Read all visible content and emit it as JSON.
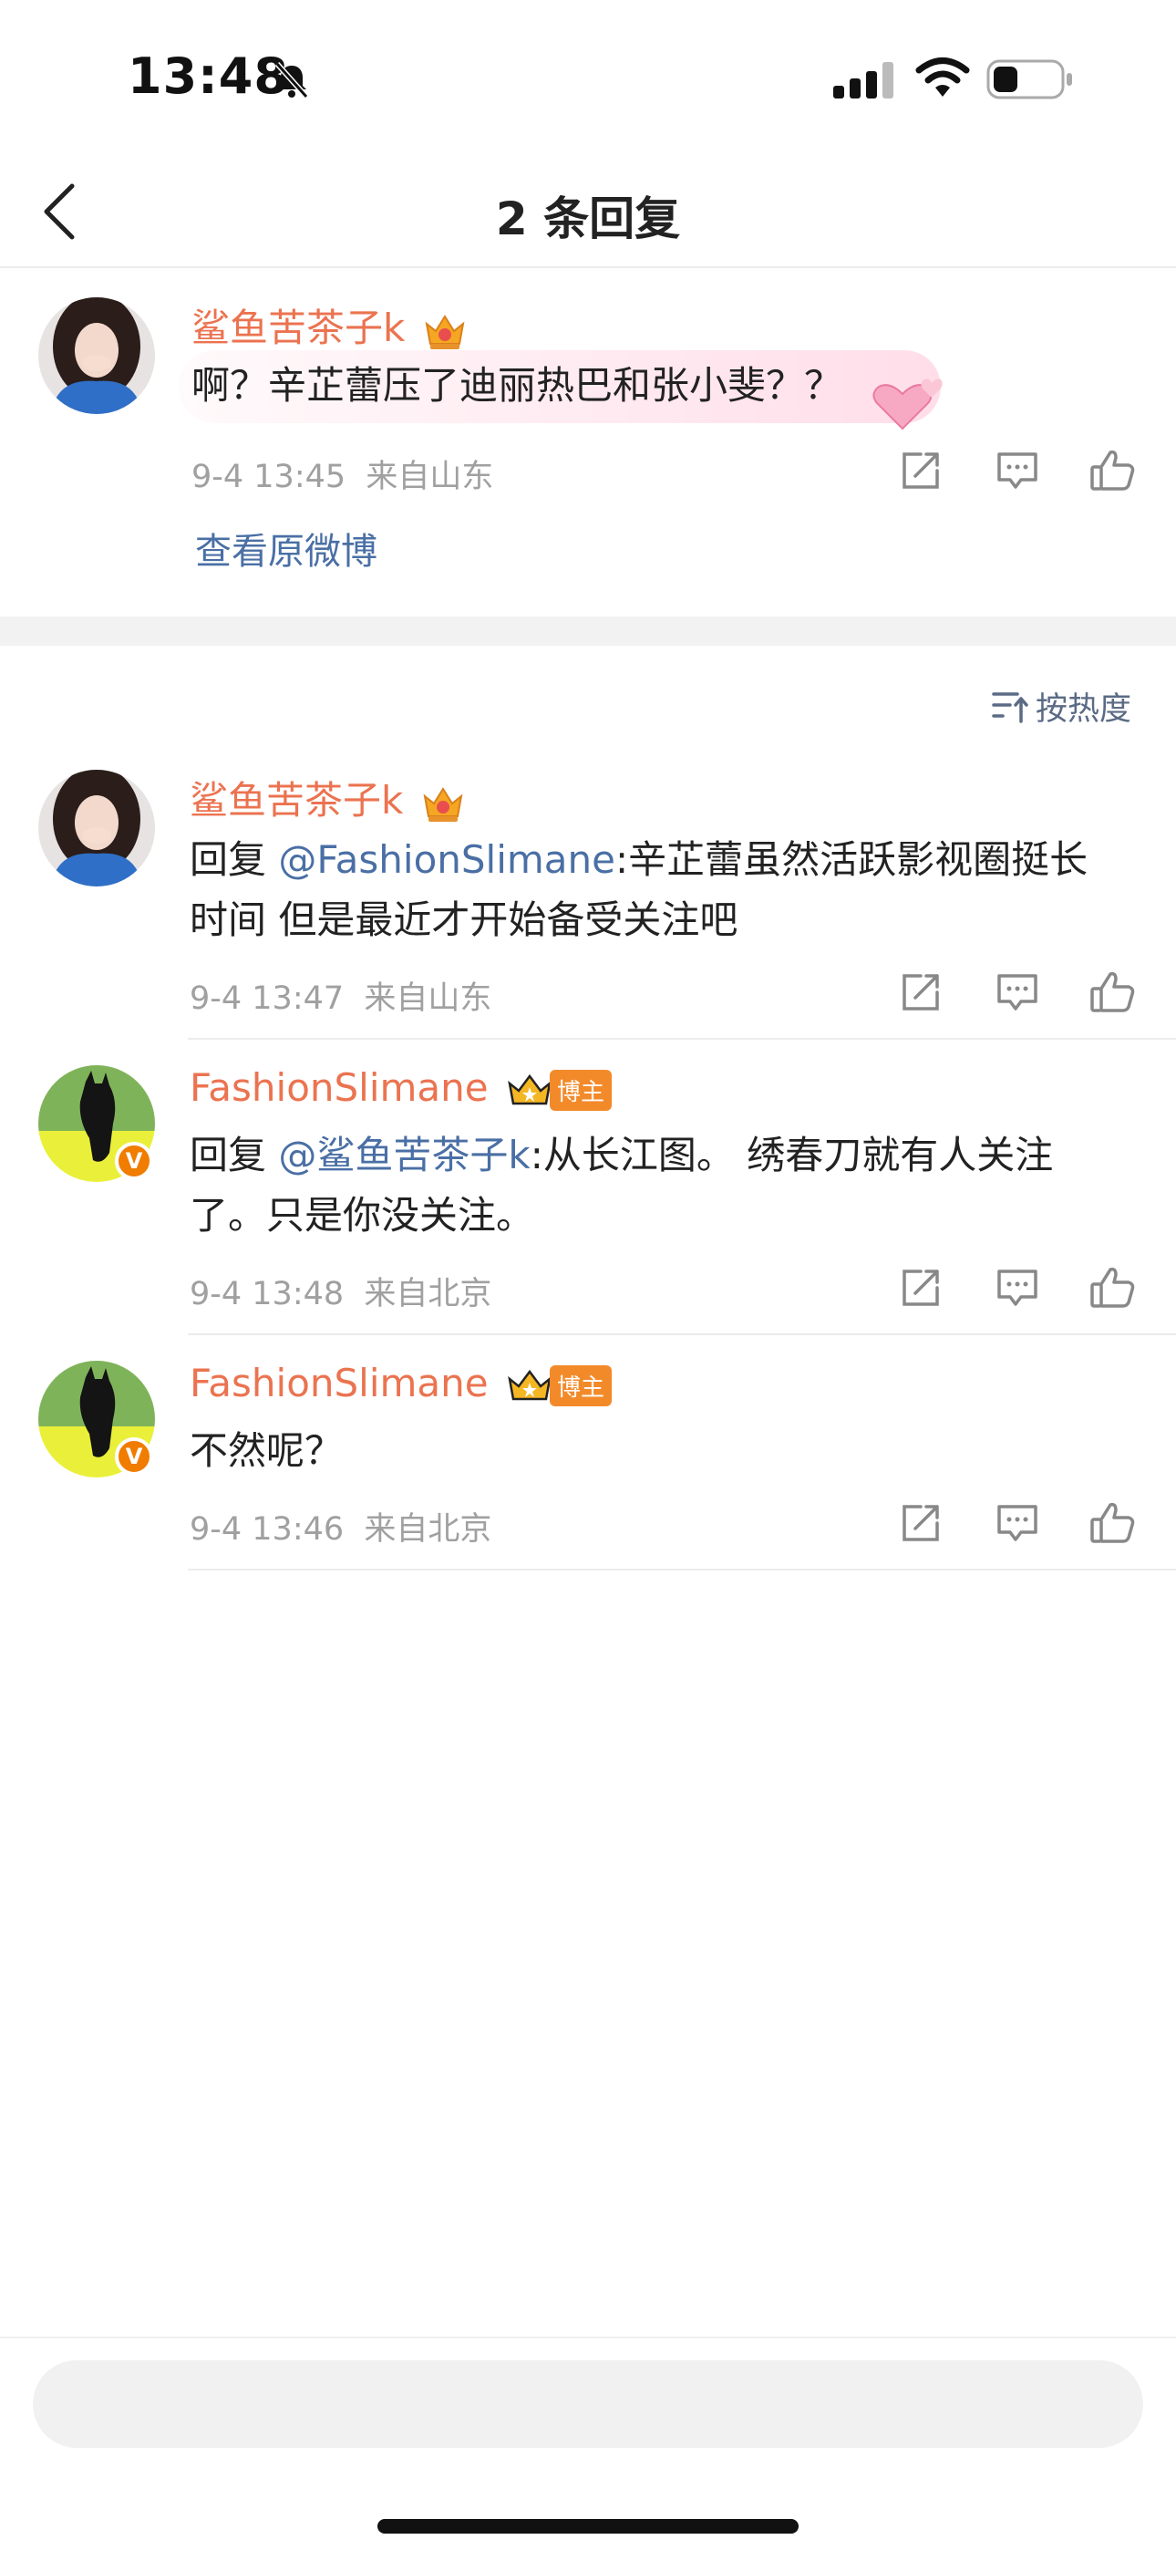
{
  "status_bar": {
    "time": "13:48"
  },
  "nav": {
    "title": "2 条回复"
  },
  "original": {
    "username": "鲨鱼苦茶子k",
    "text": "啊？辛芷蕾压了迪丽热巴和张小斐？？",
    "time": "9-4 13:45",
    "location": "来自山东",
    "view_original": "查看原微博"
  },
  "sort": {
    "label": "按热度"
  },
  "replies": [
    {
      "username": "鲨鱼苦茶子k",
      "prefix": "回复 ",
      "mention": "@FashionSlimane",
      "line1": ":辛芷蕾虽然活跃影视圈挺长",
      "line2": "时间 但是最近才开始备受关注吧",
      "time": "9-4 13:47",
      "location": "来自山东"
    },
    {
      "username": "FashionSlimane",
      "badge": "博主",
      "prefix": "回复 ",
      "mention": "@鲨鱼苦茶子k",
      "line1": ":从长江图。 绣春刀就有人关注",
      "line2": "了。只是你没关注。",
      "time": "9-4 13:48",
      "location": "来自北京"
    },
    {
      "username": "FashionSlimane",
      "badge": "博主",
      "line1": "不然呢？",
      "time": "9-4 13:46",
      "location": "来自北京"
    }
  ],
  "colors": {
    "username": "#eb7350",
    "mention": "#4a6fa5",
    "meta": "#a0a0a0",
    "badge": "#f38a2a"
  },
  "icons": [
    "bell-off-icon",
    "signal-icon",
    "wifi-icon",
    "battery-icon",
    "back-chevron-icon",
    "crown-icon",
    "repost-icon",
    "comment-icon",
    "like-icon",
    "sort-icon",
    "verified-icon"
  ]
}
